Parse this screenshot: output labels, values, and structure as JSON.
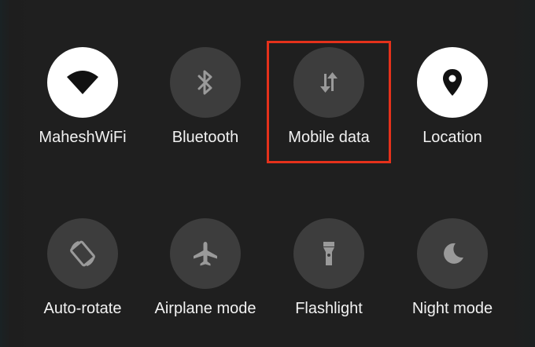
{
  "tiles": [
    {
      "label": "MaheshWiFi",
      "icon": "wifi-icon",
      "active": true
    },
    {
      "label": "Bluetooth",
      "icon": "bluetooth-icon",
      "active": false
    },
    {
      "label": "Mobile data",
      "icon": "mobile-data-icon",
      "active": false
    },
    {
      "label": "Location",
      "icon": "location-pin-icon",
      "active": true
    },
    {
      "label": "Auto-rotate",
      "icon": "auto-rotate-icon",
      "active": false
    },
    {
      "label": "Airplane mode",
      "icon": "airplane-icon",
      "active": false
    },
    {
      "label": "Flashlight",
      "icon": "flashlight-icon",
      "active": false
    },
    {
      "label": "Night mode",
      "icon": "moon-icon",
      "active": false
    }
  ],
  "highlight_color": "#e5311b",
  "active_tile_color": "#ffffff",
  "inactive_tile_color": "#3d3d3d"
}
